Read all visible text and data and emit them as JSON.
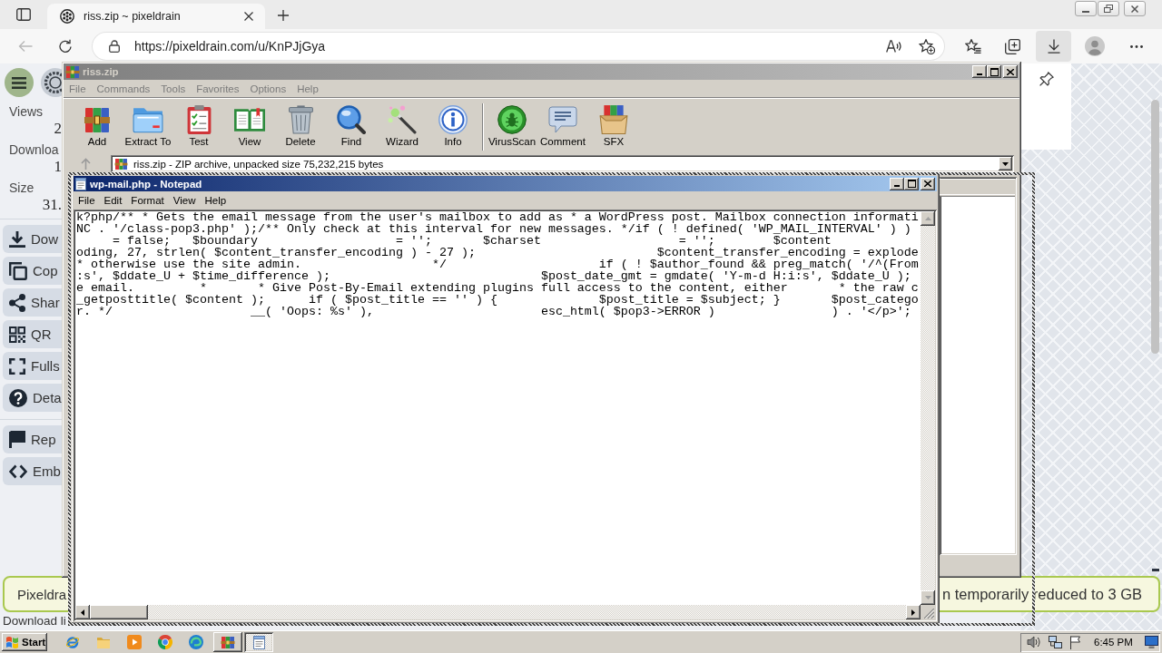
{
  "browser": {
    "tab": {
      "title": "riss.zip ~ pixeldrain",
      "selected": true
    },
    "back": {
      "disabled": true
    },
    "url": "https://pixeldrain.com/u/KnPJjGya",
    "downloads": {
      "active": true
    }
  },
  "page": {
    "stats": [
      {
        "label": "Views",
        "value": "2"
      },
      {
        "label": "Downloa",
        "value": "1"
      },
      {
        "label": "Size",
        "value": "31."
      }
    ],
    "action_groups": [
      [
        {
          "kind": "download",
          "label": "Dow"
        },
        {
          "kind": "copy",
          "label": "Cop"
        },
        {
          "kind": "share",
          "label": "Shar"
        },
        {
          "kind": "qr",
          "label": "QR"
        },
        {
          "kind": "fullscreen",
          "label": "Fulls"
        },
        {
          "kind": "details",
          "label": "Deta"
        }
      ],
      [
        {
          "kind": "report",
          "label": "Rep"
        },
        {
          "kind": "embed",
          "label": "Emb"
        }
      ]
    ],
    "banner": {
      "left": "Pixeldra",
      "right": "n temporarily reduced to 3 GB"
    },
    "download_limit": "Download li"
  },
  "winrar": {
    "title": "riss.zip",
    "menu": [
      "File",
      "Commands",
      "Tools",
      "Favorites",
      "Options",
      "Help"
    ],
    "toolbar_groups": [
      [
        {
          "kind": "add",
          "label": "Add"
        },
        {
          "kind": "extract",
          "label": "Extract To"
        },
        {
          "kind": "test",
          "label": "Test"
        },
        {
          "kind": "view",
          "label": "View"
        },
        {
          "kind": "delete",
          "label": "Delete"
        },
        {
          "kind": "find",
          "label": "Find"
        },
        {
          "kind": "wizard",
          "label": "Wizard"
        },
        {
          "kind": "info",
          "label": "Info"
        }
      ],
      [
        {
          "kind": "virus-scan",
          "label": "VirusScan"
        },
        {
          "kind": "comment",
          "label": "Comment"
        },
        {
          "kind": "sfx",
          "label": "SFX"
        }
      ]
    ],
    "path": "riss.zip - ZIP archive, unpacked size 75,232,215 bytes"
  },
  "notepad": {
    "title": "wp-mail.php - Notepad",
    "menu": [
      "File",
      "Edit",
      "Format",
      "View",
      "Help"
    ],
    "lines": [
      "k?php/** * Gets the email message from the user's mailbox to add as * a WordPress post. Mailbox connection informati",
      "NC . '/class-pop3.php' );/** Only check at this interval for new messages. */if ( ! defined( 'WP_MAIL_INTERVAL' ) )",
      "     = false;   $boundary                   = '';       $charset                   = '';        $content",
      "oding, 27, strlen( $content_transfer_encoding ) - 27 );                         $content_transfer_encoding = explode",
      "* otherwise use the site admin.                  */                     if ( ! $author_found && preg_match( '/^(From",
      ":s', $ddate_U + $time_difference );                             $post_date_gmt = gmdate( 'Y-m-d H:i:s', $ddate_U );",
      "e email.         *       * Give Post-By-Email extending plugins full access to the content, either       * the raw c",
      "_getposttitle( $content );      if ( $post_title == '' ) {              $post_title = $subject; }       $post_catego",
      "r. */                   __( 'Oops: %s' ),                       esc_html( $pop3->ERROR )                ) . '</p>';"
    ]
  },
  "taskbar": {
    "start": "Start",
    "tasks": [
      {
        "kind": "archiver",
        "selected": false
      },
      {
        "kind": "notepad",
        "selected": true
      }
    ],
    "clock": "6:45 PM"
  }
}
